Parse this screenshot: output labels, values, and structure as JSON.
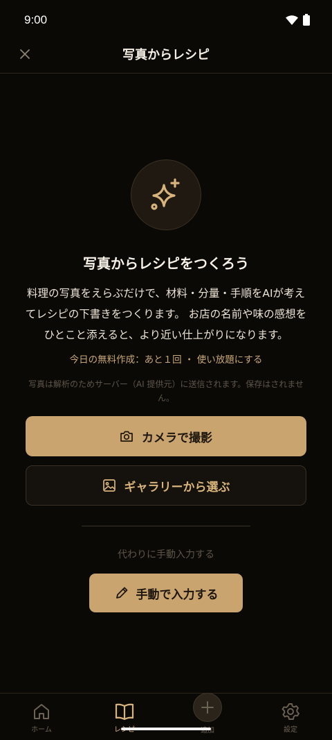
{
  "status": {
    "time": "9:00"
  },
  "app_bar": {
    "title": "写真からレシピ",
    "close_icon": "close-icon"
  },
  "hero": {
    "icon": "sparkles-icon"
  },
  "headline": "写真からレシピをつくろう",
  "description": "料理の写真をえらぶだけで、材料・分量・手順をAIが考えてレシピの下書きをつくります。 お店の名前や味の感想をひとこと添えると、より近い仕上がりになります。",
  "quota": "今日の無料作成：あと１回 ・ 使い放題にする",
  "privacy": "写真は解析のためサーバー（AI 提供元）に送信されます。保存はされません。",
  "buttons": {
    "camera": "カメラで撮影",
    "gallery": "ギャラリーから選ぶ"
  },
  "manual": {
    "caption": "代わりに手動入力する",
    "button": "手動で入力する"
  },
  "nav": {
    "items": [
      {
        "label": "ホーム",
        "icon": "home-icon"
      },
      {
        "label": "レシピ",
        "icon": "book-icon"
      },
      {
        "label": "追加",
        "icon": "add-icon"
      },
      {
        "label": "設定",
        "icon": "gear-icon"
      }
    ]
  },
  "colors": {
    "background": "#0b0906",
    "accent": "#c9a46e",
    "accent_text": "#d8b47c"
  }
}
